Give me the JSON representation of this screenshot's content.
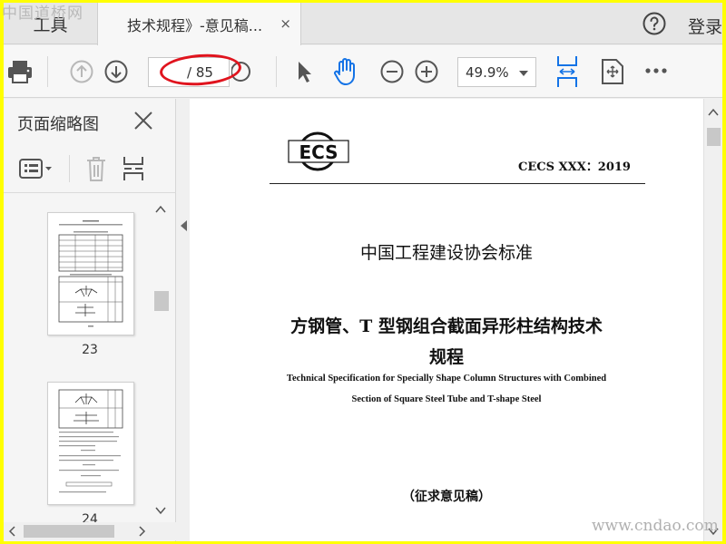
{
  "tabs": {
    "tools_label": "工具",
    "document_label": "技术规程》-意见稿...",
    "close_glyph": "×"
  },
  "header": {
    "login_label": "登录"
  },
  "toolbar": {
    "current_page": "",
    "total_pages": "/ 85",
    "zoom": "49.9%"
  },
  "left_panel": {
    "title": "页面缩略图",
    "thumbnails": [
      {
        "page_number": "23"
      },
      {
        "page_number": "24"
      }
    ]
  },
  "document": {
    "logo_text": "ECS",
    "standard_code": "CECS XXX：2019",
    "organization": "中国工程建设协会标准",
    "title_line1": "方钢管、T 型钢组合截面异形柱结构技术",
    "title_line2": "规程",
    "title_en_line1": "Technical Specification for Specially Shape Column Structures with Combined",
    "title_en_line2": "Section of Square Steel Tube and T-shape Steel",
    "draft_label": "（征求意见稿）"
  },
  "watermarks": {
    "top": "中国道桥网",
    "bottom": "www.cndao.com"
  },
  "colors": {
    "frame_border": "#ffff00",
    "annotation_ellipse": "#e0141e",
    "icon_accent": "#1473e6"
  }
}
